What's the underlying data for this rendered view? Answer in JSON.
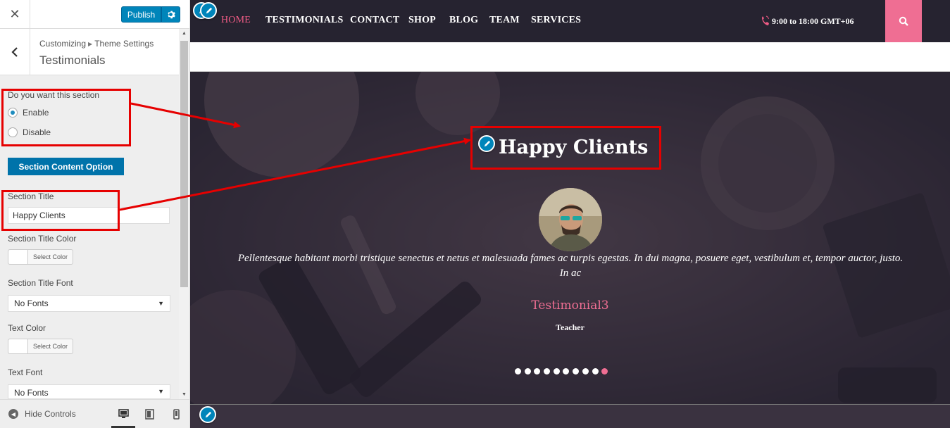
{
  "customizer": {
    "close_icon": "close-icon",
    "publish_label": "Publish",
    "gear_icon": "gear-icon",
    "breadcrumb": {
      "root": "Customizing",
      "parent": "Theme Settings"
    },
    "panel_title": "Testimonials",
    "enable_section": {
      "label": "Do you want this section",
      "options": [
        "Enable",
        "Disable"
      ],
      "selected": "Enable"
    },
    "section_content_button": "Section Content Option",
    "section_title": {
      "label": "Section Title",
      "value": "Happy Clients"
    },
    "section_title_color": {
      "label": "Section Title Color",
      "button": "Select Color"
    },
    "section_title_font": {
      "label": "Section Title Font",
      "value": "No Fonts"
    },
    "text_color": {
      "label": "Text Color",
      "button": "Select Color"
    },
    "text_font": {
      "label": "Text Font",
      "value": "No Fonts"
    },
    "footer": {
      "hide_controls": "Hide Controls",
      "devices": [
        "desktop-icon",
        "tablet-icon",
        "mobile-icon"
      ],
      "active_device": "desktop"
    }
  },
  "preview": {
    "nav": {
      "items": [
        "HOME",
        "TESTIMONIALS",
        "CONTACT",
        "SHOP",
        "BLOG",
        "TEAM",
        "SERVICES"
      ],
      "active": "HOME",
      "hours": "9:00 to 18:00 GMT+06",
      "search_icon": "search-icon"
    },
    "testimonials": {
      "title": "Happy Clients",
      "quote": "Pellentesque habitant morbi tristique senectus et netus et malesuada fames ac turpis egestas. In dui magna, posuere eget, vestibulum et, tempor auctor, justo. In ac",
      "name": "Testimonial3",
      "role": "Teacher",
      "slide_count": 10,
      "active_slide": 10
    }
  },
  "colors": {
    "accent_pink": "#ef6e93",
    "wp_blue": "#0085ba",
    "nav_bg": "#262330",
    "annotation_red": "#e60000"
  }
}
